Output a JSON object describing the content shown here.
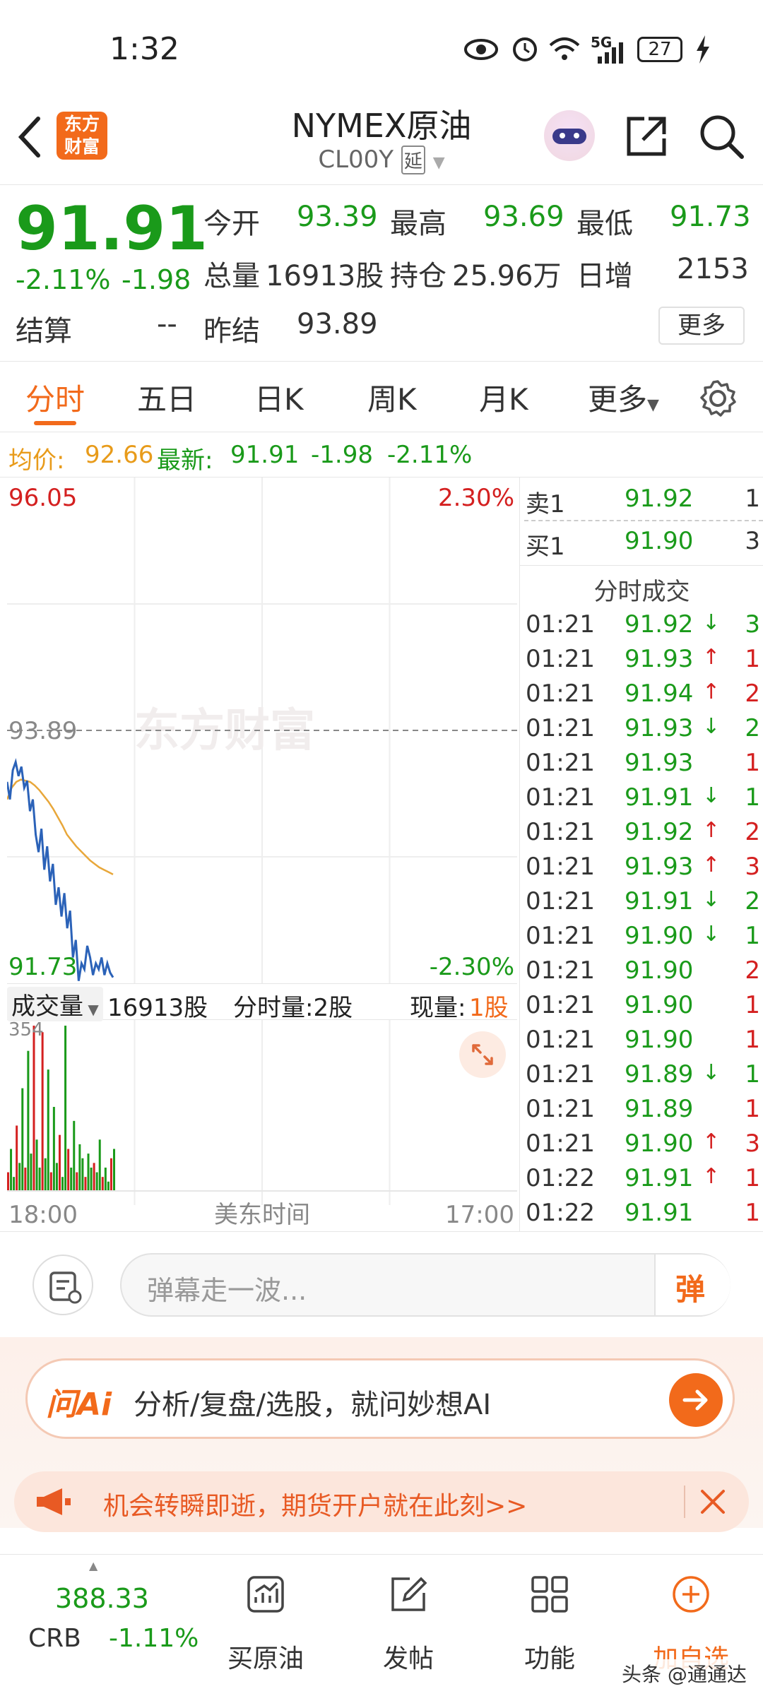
{
  "status_bar": {
    "time": "1:32",
    "battery": "27",
    "network": "5G"
  },
  "header": {
    "back_icon": "chevron-left-icon",
    "logo_text": "东方财富",
    "title": "NYMEX原油",
    "code": "CL00Y",
    "delay_badge": "延",
    "share_icon": "share-icon",
    "search_icon": "search-icon"
  },
  "quote": {
    "price": "91.91",
    "change_pct": "-2.11%",
    "change": "-1.98",
    "open_label": "今开",
    "open": "93.39",
    "high_label": "最高",
    "high": "93.69",
    "low_label": "最低",
    "low": "91.73",
    "volume_label": "总量",
    "volume": "16913股",
    "oi_label": "持仓",
    "oi": "25.96万",
    "daily_inc_label": "日增",
    "daily_inc": "2153",
    "settle_label": "结算",
    "settle": "--",
    "prev_settle_label": "昨结",
    "prev_settle": "93.89",
    "more_button": "更多"
  },
  "tabs": [
    {
      "label": "分时",
      "active": true
    },
    {
      "label": "五日"
    },
    {
      "label": "日K"
    },
    {
      "label": "周K"
    },
    {
      "label": "月K"
    },
    {
      "label": "更多"
    }
  ],
  "avg_line": {
    "avg_label": "均价:",
    "avg_value": "92.66",
    "latest_label": "最新:",
    "latest_value": "91.91",
    "latest_change": "-1.98",
    "latest_pct": "-2.11%"
  },
  "chart_data": {
    "type": "line",
    "title": "",
    "xlabel": "美东时间",
    "x_start": "18:00",
    "x_end": "17:00",
    "y_max_label": "96.05",
    "y_min_label": "91.73",
    "y_max_pct": "2.30%",
    "y_min_pct": "-2.30%",
    "ref_label": "93.89",
    "watermark": "东方财富",
    "ylim": [
      91.73,
      96.05
    ],
    "reference": 93.89,
    "series": [
      {
        "values": [
          93.45,
          93.3,
          93.55,
          93.62,
          93.5,
          93.58,
          93.4,
          93.46,
          93.2,
          93.3,
          93.0,
          92.85,
          93.05,
          92.7,
          92.9,
          92.6,
          92.75,
          92.4,
          92.55,
          92.3,
          92.5,
          92.2,
          92.35,
          91.95,
          92.1,
          91.75,
          91.9,
          91.85,
          92.05,
          91.95,
          91.8,
          91.9,
          91.85,
          91.95,
          91.8,
          91.9,
          91.82,
          91.78
        ]
      },
      {
        "values": [
          93.3,
          93.4,
          93.45,
          93.47,
          93.46,
          93.45,
          93.42,
          93.38,
          93.33,
          93.28,
          93.22,
          93.15,
          93.08,
          93.0,
          92.95,
          92.9,
          92.86,
          92.82,
          92.78,
          92.75,
          92.72,
          92.7,
          92.68,
          92.66
        ]
      }
    ],
    "volume_label": "成交量",
    "volume_total": "16913股",
    "interval_vol_label": "分时量:2股",
    "current_vol_label": "现量:",
    "current_vol": "1股",
    "volume_max": "354",
    "volumes": [
      40,
      90,
      30,
      140,
      60,
      220,
      50,
      300,
      80,
      354,
      110,
      50,
      340,
      70,
      260,
      40,
      180,
      60,
      120,
      30,
      354,
      90,
      50,
      150,
      40,
      100,
      70,
      30,
      80,
      50,
      60,
      40,
      110,
      30,
      50,
      20,
      70,
      90
    ]
  },
  "order_book": {
    "ask_label": "卖1",
    "ask_price": "91.92",
    "ask_qty": "1",
    "bid_label": "买1",
    "bid_price": "91.90",
    "bid_qty": "3",
    "trades_title": "分时成交",
    "trades": [
      {
        "time": "01:21",
        "price": "91.92",
        "dir": "down",
        "qty": "3"
      },
      {
        "time": "01:21",
        "price": "91.93",
        "dir": "up",
        "qty": "1"
      },
      {
        "time": "01:21",
        "price": "91.94",
        "dir": "up",
        "qty": "2"
      },
      {
        "time": "01:21",
        "price": "91.93",
        "dir": "down",
        "qty": "2"
      },
      {
        "time": "01:21",
        "price": "91.93",
        "dir": "",
        "qty": "1"
      },
      {
        "time": "01:21",
        "price": "91.91",
        "dir": "down",
        "qty": "1"
      },
      {
        "time": "01:21",
        "price": "91.92",
        "dir": "up",
        "qty": "2"
      },
      {
        "time": "01:21",
        "price": "91.93",
        "dir": "up",
        "qty": "3"
      },
      {
        "time": "01:21",
        "price": "91.91",
        "dir": "down",
        "qty": "2"
      },
      {
        "time": "01:21",
        "price": "91.90",
        "dir": "down",
        "qty": "1"
      },
      {
        "time": "01:21",
        "price": "91.90",
        "dir": "",
        "qty": "2"
      },
      {
        "time": "01:21",
        "price": "91.90",
        "dir": "",
        "qty": "1"
      },
      {
        "time": "01:21",
        "price": "91.90",
        "dir": "",
        "qty": "1"
      },
      {
        "time": "01:21",
        "price": "91.89",
        "dir": "down",
        "qty": "1"
      },
      {
        "time": "01:21",
        "price": "91.89",
        "dir": "",
        "qty": "1"
      },
      {
        "time": "01:21",
        "price": "91.90",
        "dir": "up",
        "qty": "3"
      },
      {
        "time": "01:22",
        "price": "91.91",
        "dir": "up",
        "qty": "1"
      },
      {
        "time": "01:22",
        "price": "91.91",
        "dir": "",
        "qty": "1"
      }
    ]
  },
  "danmu": {
    "placeholder": "弹幕走一波...",
    "send_label": "弹"
  },
  "ai_bar": {
    "logo": "问Ai",
    "text": "分析/复盘/选股，就问妙想AI"
  },
  "promo": {
    "text": "机会转瞬即逝，期货开户就在此刻>>"
  },
  "bottom_nav": {
    "index_value": "388.33",
    "index_name": "CRB",
    "index_change": "-1.11%",
    "items": [
      {
        "label": "买原油",
        "icon": "chart-buy-icon"
      },
      {
        "label": "发帖",
        "icon": "edit-icon"
      },
      {
        "label": "功能",
        "icon": "grid-icon"
      },
      {
        "label": "加自选",
        "icon": "plus-circle-icon"
      }
    ]
  },
  "watermark_footer": "头条 @通通达",
  "colors": {
    "up": "#d42020",
    "down": "#1a9a1a",
    "accent": "#f26a1b",
    "avg": "#e8a73a",
    "line": "#2b62b8"
  }
}
